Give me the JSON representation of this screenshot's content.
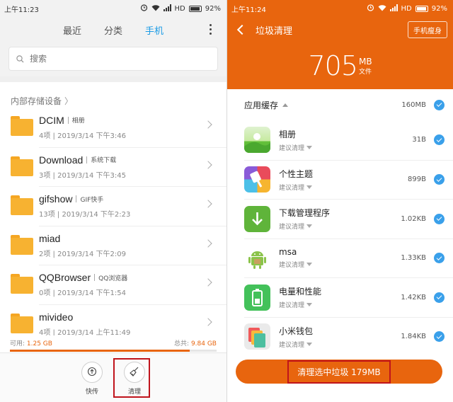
{
  "left": {
    "status": {
      "time": "上午11:23",
      "signal": "HD",
      "battery": "92%"
    },
    "tabs": [
      "最近",
      "分类",
      "手机"
    ],
    "active_tab": 2,
    "search_placeholder": "搜索",
    "storage_title": "内部存储设备",
    "folders": [
      {
        "name": "DCIM",
        "label": "相册",
        "meta": "4项 | 2019/3/14 下午3:46"
      },
      {
        "name": "Download",
        "label": "系统下载",
        "meta": "3项 | 2019/3/14 下午3:45"
      },
      {
        "name": "gifshow",
        "label": "GIF快手",
        "meta": "13项 | 2019/3/14 下午2:23"
      },
      {
        "name": "miad",
        "label": "",
        "meta": "2项 | 2019/3/14 下午2:09"
      },
      {
        "name": "QQBrowser",
        "label": "QQ浏览器",
        "meta": "0项 | 2019/3/14 下午1:54"
      },
      {
        "name": "mivideo",
        "label": "",
        "meta": "4项 | 2019/3/14 上午11:49"
      }
    ],
    "usage": {
      "available": "可用: ",
      "available_value": "1.25 GB",
      "total": "总共: ",
      "total_value": "9.84 GB",
      "used_fraction": 0.87
    },
    "bottom": {
      "share": "快传",
      "clean": "清理"
    }
  },
  "right": {
    "status": {
      "time": "上午11:24",
      "signal": "HD",
      "battery": "92%"
    },
    "title": "垃圾清理",
    "slim_button": "手机瘦身",
    "total_value": "705",
    "total_unit": "MB",
    "total_label": "文件",
    "section": {
      "title": "应用缓存",
      "size": "160MB"
    },
    "apps": [
      {
        "name": "相册",
        "sub": "建议清理",
        "size": "31B",
        "icon": "gallery-icon"
      },
      {
        "name": "个性主题",
        "sub": "建议清理",
        "size": "899B",
        "icon": "themes-icon"
      },
      {
        "name": "下载管理程序",
        "sub": "建议清理",
        "size": "1.02KB",
        "icon": "download-manager-icon"
      },
      {
        "name": "msa",
        "sub": "建议清理",
        "size": "1.33KB",
        "icon": "android-icon"
      },
      {
        "name": "电量和性能",
        "sub": "建议清理",
        "size": "1.42KB",
        "icon": "battery-icon"
      },
      {
        "name": "小米钱包",
        "sub": "建议清理",
        "size": "1.84KB",
        "icon": "wallet-icon"
      }
    ],
    "clean_button": "清理选中垃圾 179MB"
  },
  "colors": {
    "accent_orange": "#e8650e",
    "tab_blue": "#1a9be5",
    "check_blue": "#3aa0ea",
    "highlight_red": "#c0141c"
  }
}
